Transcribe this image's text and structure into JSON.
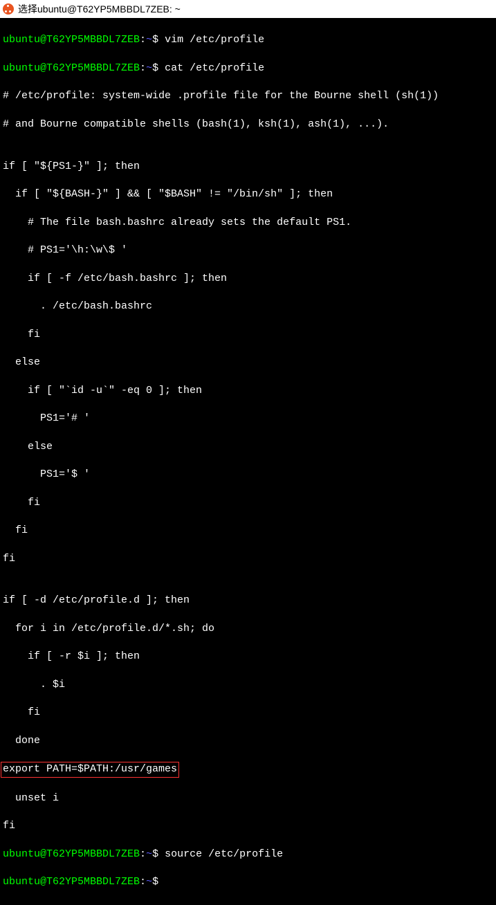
{
  "titlebar": {
    "text": "选择ubuntu@T62YP5MBBDL7ZEB: ~"
  },
  "prompts": {
    "user_host": "ubuntu@T62YP5MBBDL7ZEB",
    "colon": ":",
    "path": "~",
    "dollar": "$"
  },
  "commands": {
    "cmd1": " vim /etc/profile",
    "cmd2": " cat /etc/profile",
    "cmd3": " source /etc/profile",
    "cmd4": ""
  },
  "output": {
    "l01": "# /etc/profile: system-wide .profile file for the Bourne shell (sh(1))",
    "l02": "# and Bourne compatible shells (bash(1), ksh(1), ash(1), ...).",
    "l03": "",
    "l04": "if [ \"${PS1-}\" ]; then",
    "l05": "  if [ \"${BASH-}\" ] && [ \"$BASH\" != \"/bin/sh\" ]; then",
    "l06": "    # The file bash.bashrc already sets the default PS1.",
    "l07": "    # PS1='\\h:\\w\\$ '",
    "l08": "    if [ -f /etc/bash.bashrc ]; then",
    "l09": "      . /etc/bash.bashrc",
    "l10": "    fi",
    "l11": "  else",
    "l12": "    if [ \"`id -u`\" -eq 0 ]; then",
    "l13": "      PS1='# '",
    "l14": "    else",
    "l15": "      PS1='$ '",
    "l16": "    fi",
    "l17": "  fi",
    "l18": "fi",
    "l19": "",
    "l20": "if [ -d /etc/profile.d ]; then",
    "l21": "  for i in /etc/profile.d/*.sh; do",
    "l22": "    if [ -r $i ]; then",
    "l23": "      . $i",
    "l24": "    fi",
    "l25": "  done",
    "l26": "export PATH=$PATH:/usr/games",
    "l27": "  unset i",
    "l28": "fi"
  }
}
